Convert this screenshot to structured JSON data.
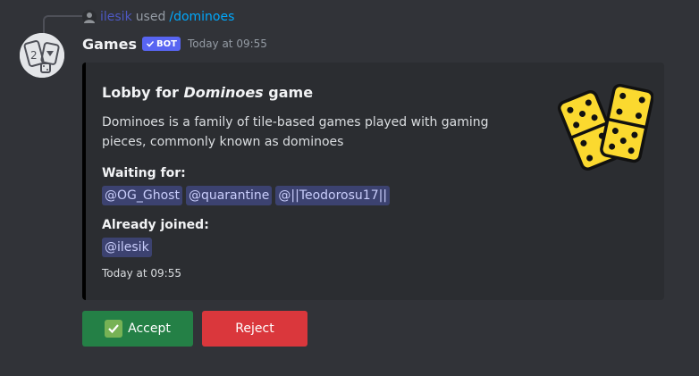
{
  "reference": {
    "username": "ilesik",
    "used_text": "used",
    "command": "/dominoes"
  },
  "message": {
    "username": "Games",
    "bot_tag": "BOT",
    "timestamp": "Today at 09:55"
  },
  "embed": {
    "title_prefix": "Lobby for ",
    "title_game": "Dominoes",
    "title_suffix": " game",
    "description": "Dominoes is a family of tile-based games played with gaming pieces, commonly known as dominoes",
    "fields": [
      {
        "name": "Waiting for:",
        "mentions": [
          "@OG_Ghost",
          "@quarantine",
          "@||Teodorosu17||"
        ]
      },
      {
        "name": "Already joined:",
        "mentions": [
          "@ilesik"
        ]
      }
    ],
    "footer": "Today at 09:55",
    "border_color": "#000000"
  },
  "buttons": {
    "accept_label": "Accept",
    "reject_label": "Reject",
    "accept_color": "#248046",
    "reject_color": "#da373c"
  },
  "icons": {
    "ref_avatar": "user-avatar-icon",
    "bot_check": "check-icon",
    "thumbnail": "dominoes-icon",
    "accept": "check-mark-button-icon"
  }
}
